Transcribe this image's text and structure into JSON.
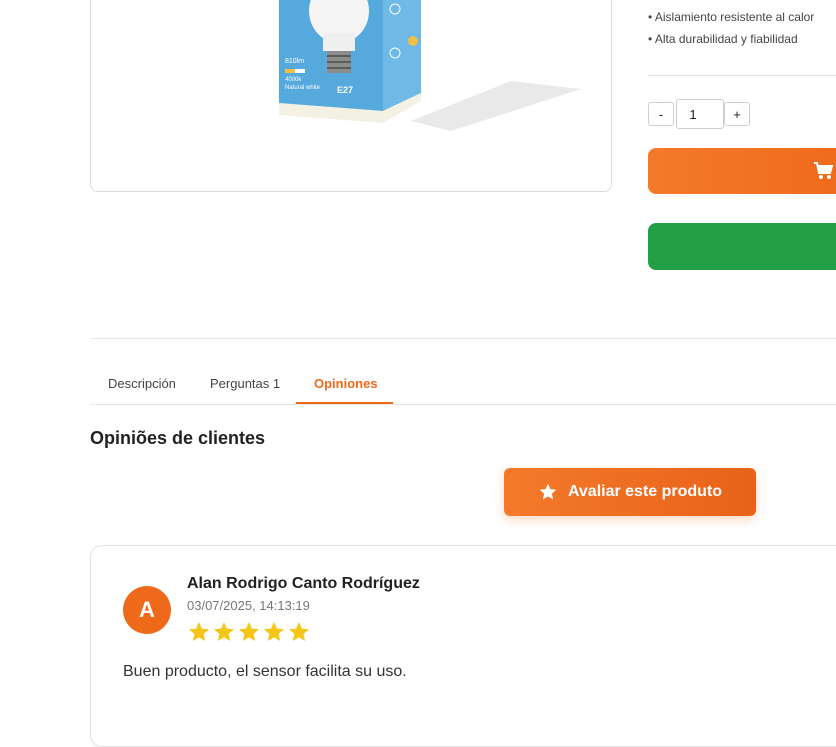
{
  "product": {
    "features": [
      "• Aislamiento resistente al calor",
      "• Alta durabilidad y fiabilidad"
    ],
    "image_label": "E27",
    "image_lumens": "810lm",
    "image_temp": "4000k",
    "image_white": "Natural white"
  },
  "purchase": {
    "qty_minus": "-",
    "qty_value": "1",
    "qty_plus": "+",
    "cart_icon": "cart-icon",
    "accent": "#ee6a1a",
    "green": "#23a045"
  },
  "tabs": [
    {
      "label": "Descripción"
    },
    {
      "label": "Perguntas 1"
    },
    {
      "label": "Opiniones"
    }
  ],
  "reviews": {
    "title": "Opiniões de clientes",
    "rate_button": "Avaliar este produto",
    "items": [
      {
        "initial": "A",
        "name": "Alan Rodrigo Canto Rodríguez",
        "date": "03/07/2025, 14:13:19",
        "rating": 5,
        "text": "Buen producto, el sensor facilita su uso."
      }
    ]
  }
}
